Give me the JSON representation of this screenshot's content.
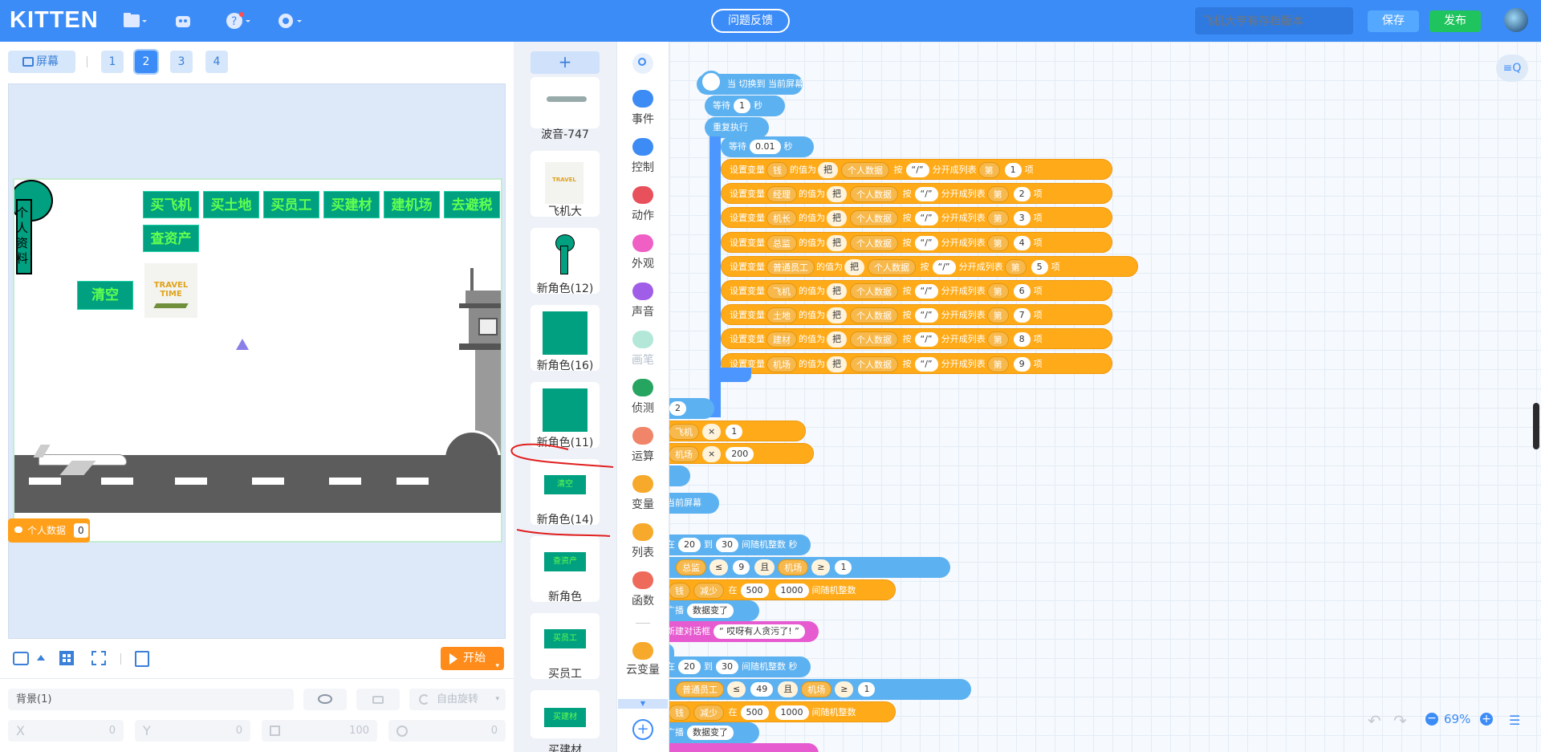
{
  "app": {
    "logo": "KITTEN"
  },
  "topbar": {
    "feedback_label": "问题反馈",
    "search_placeholder": "飞机大亨有存档版本",
    "save_label": "保存",
    "publish_label": "发布"
  },
  "screens": {
    "screen_toggle_label": "屏幕",
    "tabs": [
      "1",
      "2",
      "3",
      "4"
    ],
    "active": "2"
  },
  "stage": {
    "buttons": [
      "买飞机",
      "买土地",
      "买员工",
      "买建材",
      "建机场",
      "去避税",
      "查资产"
    ],
    "clear_label": "清空",
    "profile_label": "个人资料",
    "logo_text": "TRAVEL TIME",
    "variable_monitor": {
      "name": "个人数据",
      "value": "0"
    }
  },
  "controls": {
    "start_label": "开始"
  },
  "properties": {
    "sprite_name": "背景(1)",
    "rotation_label": "自由旋转",
    "x_label": "X",
    "x_value": "0",
    "y_label": "Y",
    "y_value": "0",
    "size_value": "100",
    "direction_value": "0"
  },
  "sprites": [
    {
      "name": "波音-747"
    },
    {
      "name": "飞机大"
    },
    {
      "name": "新角色(12)"
    },
    {
      "name": "新角色(16)"
    },
    {
      "name": "新角色(11)"
    },
    {
      "name": "新角色(14)"
    },
    {
      "name": "新角色"
    },
    {
      "name": "买员工"
    },
    {
      "name": "买建材"
    }
  ],
  "categories": [
    {
      "name": "事件",
      "color": "#3d8bf5"
    },
    {
      "name": "控制",
      "color": "#3d8bf5"
    },
    {
      "name": "动作",
      "color": "#e8505b"
    },
    {
      "name": "外观",
      "color": "#ef5fc4"
    },
    {
      "name": "声音",
      "color": "#a05ee8"
    },
    {
      "name": "画笔",
      "color": "#b3e8d9"
    },
    {
      "name": "侦测",
      "color": "#25a55f"
    },
    {
      "name": "运算",
      "color": "#f0856a"
    },
    {
      "name": "变量",
      "color": "#f7a92b"
    },
    {
      "name": "列表",
      "color": "#f7a92b"
    },
    {
      "name": "函数",
      "color": "#ee6a5b"
    },
    {
      "name": "云变量",
      "color": "#f7a92b"
    }
  ],
  "script": {
    "hat": "当 切换到 当前屏幕",
    "wait1": {
      "label": "等待",
      "value": "1",
      "unit": "秒"
    },
    "repeat": "重复执行",
    "wait2": {
      "label": "等待",
      "value": "0.01",
      "unit": "秒"
    },
    "set_rows": [
      {
        "var": "钱",
        "idx": "1"
      },
      {
        "var": "经理",
        "idx": "2"
      },
      {
        "var": "机长",
        "idx": "3"
      },
      {
        "var": "总监",
        "idx": "4"
      },
      {
        "var": "普通员工",
        "idx": "5"
      },
      {
        "var": "飞机",
        "idx": "6"
      },
      {
        "var": "土地",
        "idx": "7"
      },
      {
        "var": "建材",
        "idx": "8"
      },
      {
        "var": "机场",
        "idx": "9"
      }
    ],
    "set_words": {
      "set": "设置变量",
      "valueof": "的值为",
      "take": "把",
      "data": "个人数据",
      "by": "按",
      "sep": "“/”",
      "split": "分开成列表",
      "nth": "第",
      "item": "项"
    },
    "lower": {
      "v2": "2",
      "plane": "飞机",
      "x": "×",
      "one": "1",
      "airport": "机场",
      "v200": "200",
      "hat2": "当前屏幕",
      "rand1": {
        "from": "20",
        "to": "30",
        "text": "间随机整数",
        "in": "在",
        "and": "到",
        "unit": "秒"
      },
      "cond1": {
        "a": "总监",
        "op": "≤",
        "b": "9",
        "and": "且",
        "c": "机场",
        "op2": "≥",
        "d": "1"
      },
      "money": {
        "var": "钱",
        "op": "减少",
        "in": "在",
        "from": "500",
        "to": "1000",
        "text": "间随机整数"
      },
      "broadcast": {
        "label": "广播",
        "msg": "数据变了"
      },
      "dialog": {
        "label": "新建对话框",
        "text": "“ 哎呀有人贪污了! ”"
      },
      "rand2": {
        "from": "20",
        "to": "30"
      },
      "cond2": {
        "a": "普通员工",
        "op": "≤",
        "b": "49",
        "and": "且",
        "c": "机场",
        "op2": "≥",
        "d": "1"
      },
      "money2": {
        "from": "500",
        "to": "1000"
      },
      "broadcast2": {
        "msg": "数据变了"
      }
    }
  },
  "zoom": {
    "level": "69%"
  }
}
